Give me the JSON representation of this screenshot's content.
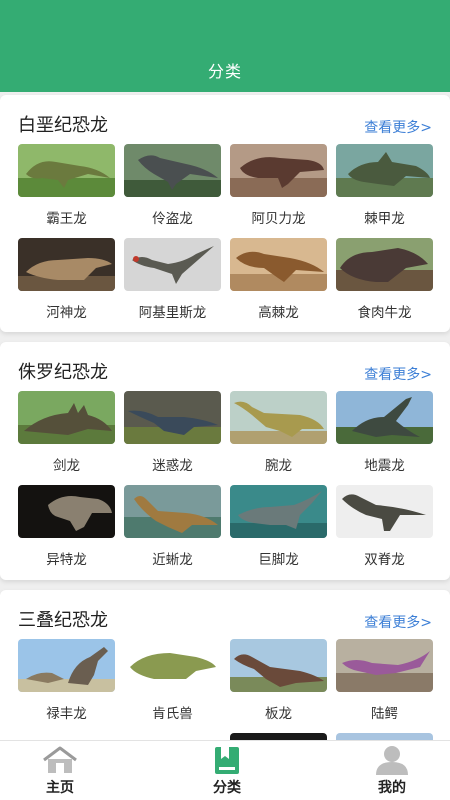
{
  "header": {
    "title": "分类"
  },
  "sections": [
    {
      "title": "白垩纪恐龙",
      "more": "查看更多>",
      "items": [
        {
          "label": "霸王龙",
          "image": "tyrannosaurus-photo"
        },
        {
          "label": "伶盗龙",
          "image": "velociraptor-photo"
        },
        {
          "label": "阿贝力龙",
          "image": "abelisaurus-photo"
        },
        {
          "label": "棘甲龙",
          "image": "acanthopholis-photo"
        },
        {
          "label": "河神龙",
          "image": "potamosaurus-photo"
        },
        {
          "label": "阿基里斯龙",
          "image": "achillobator-photo"
        },
        {
          "label": "高棘龙",
          "image": "acrocanthosaurus-photo"
        },
        {
          "label": "食肉牛龙",
          "image": "carnotaurus-photo"
        }
      ]
    },
    {
      "title": "侏罗纪恐龙",
      "more": "查看更多>",
      "items": [
        {
          "label": "剑龙",
          "image": "stegosaurus-photo"
        },
        {
          "label": "迷惑龙",
          "image": "apatosaurus-photo"
        },
        {
          "label": "腕龙",
          "image": "brachiosaurus-photo"
        },
        {
          "label": "地震龙",
          "image": "seismosaurus-photo"
        },
        {
          "label": "异特龙",
          "image": "allosaurus-photo"
        },
        {
          "label": "近蜥龙",
          "image": "anchisaurus-photo"
        },
        {
          "label": "巨脚龙",
          "image": "barapasaurus-photo"
        },
        {
          "label": "双脊龙",
          "image": "dilophosaurus-photo"
        }
      ]
    },
    {
      "title": "三叠纪恐龙",
      "more": "查看更多>",
      "items": [
        {
          "label": "禄丰龙",
          "image": "lufengosaurus-photo"
        },
        {
          "label": "肯氏兽",
          "image": "kannemeyeria-photo"
        },
        {
          "label": "板龙",
          "image": "plateosaurus-photo"
        },
        {
          "label": "陆鳄",
          "image": "terrestrisuchus-photo"
        }
      ]
    }
  ],
  "tabbar": {
    "items": [
      {
        "label": "主页",
        "icon": "home-icon"
      },
      {
        "label": "分类",
        "icon": "book-icon"
      },
      {
        "label": "我的",
        "icon": "user-icon"
      }
    ],
    "active_color": "#34ac73",
    "inactive_color": "#9a9a9a"
  },
  "colors": {
    "header": "#34ac73",
    "link": "#3d7fd6"
  }
}
